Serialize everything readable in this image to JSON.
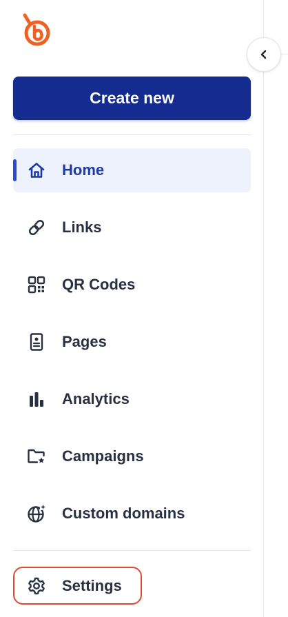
{
  "brand": {
    "logo_icon": "bitly-logo-icon",
    "logo_color": "#ee6123"
  },
  "sidebar": {
    "collapse_icon": "chevron-left-icon",
    "create_button_label": "Create new",
    "items": [
      {
        "id": "home",
        "label": "Home",
        "icon": "home-icon",
        "active": true
      },
      {
        "id": "links",
        "label": "Links",
        "icon": "link-icon",
        "active": false
      },
      {
        "id": "qr-codes",
        "label": "QR Codes",
        "icon": "qr-code-icon",
        "active": false
      },
      {
        "id": "pages",
        "label": "Pages",
        "icon": "page-icon",
        "active": false
      },
      {
        "id": "analytics",
        "label": "Analytics",
        "icon": "bar-chart-icon",
        "active": false
      },
      {
        "id": "campaigns",
        "label": "Campaigns",
        "icon": "folder-star-icon",
        "active": false
      },
      {
        "id": "custom-domains",
        "label": "Custom domains",
        "icon": "globe-sparkle-icon",
        "active": false
      }
    ],
    "settings": {
      "label": "Settings",
      "icon": "gear-icon"
    }
  },
  "colors": {
    "primary": "#142b8f",
    "active_text": "#1d3aa8",
    "active_bg": "#edf2fd",
    "text": "#273142",
    "highlight": "#e04a2e"
  }
}
